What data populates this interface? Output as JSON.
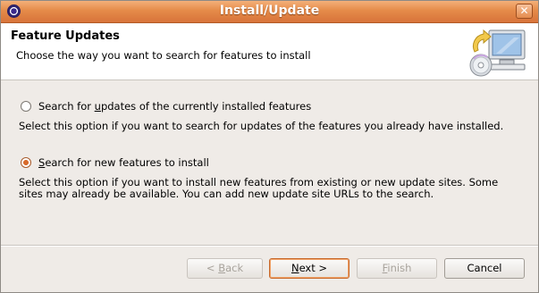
{
  "window": {
    "title": "Install/Update"
  },
  "header": {
    "title": "Feature Updates",
    "description": "Choose the way you want to search for features to install"
  },
  "options": [
    {
      "label_pre": "Search for ",
      "label_mnemonic": "u",
      "label_post": "pdates of the currently installed features",
      "checked": false,
      "description": "Select this option if you want to search for updates of the features you already have installed."
    },
    {
      "label_pre": "",
      "label_mnemonic": "S",
      "label_post": "earch for new features to install",
      "checked": true,
      "description_line1": "Select this option if you want to install new features from existing or new update sites. Some",
      "description_line2": "sites may already be available. You can add new update site URLs to the search."
    }
  ],
  "buttons": {
    "back": {
      "pre": "< ",
      "mn": "B",
      "post": "ack",
      "enabled": false
    },
    "next": {
      "pre": "",
      "mn": "N",
      "post": "ext >",
      "enabled": true
    },
    "finish": {
      "pre": "",
      "mn": "F",
      "post": "inish",
      "enabled": false
    },
    "cancel": {
      "label": "Cancel",
      "enabled": true
    }
  },
  "icons": {
    "app": "eclipse-icon",
    "close": "close-icon",
    "wizard": "update-computer-cd-icon"
  },
  "colors": {
    "titlebar": "#e58b49",
    "accent": "#d86a2a"
  }
}
